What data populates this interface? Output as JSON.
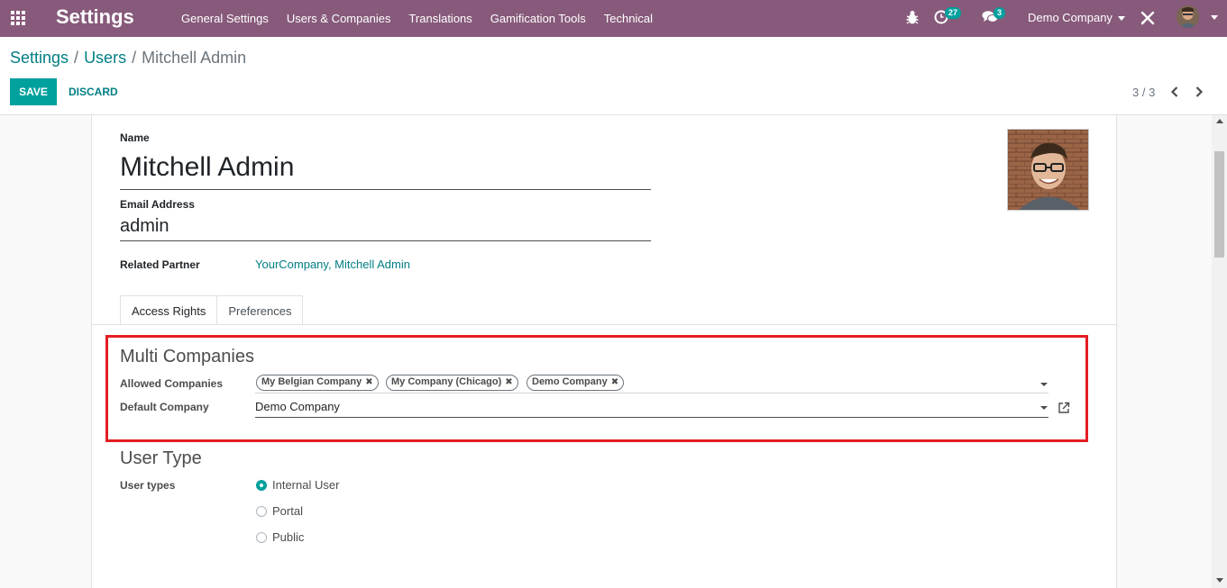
{
  "navbar": {
    "app_title": "Settings",
    "menu": [
      "General Settings",
      "Users & Companies",
      "Translations",
      "Gamification Tools",
      "Technical"
    ],
    "activity_count": "27",
    "message_count": "3",
    "company": "Demo Company",
    "icons": [
      "apps-icon",
      "bug-icon",
      "clock-icon",
      "chat-icon",
      "tools-icon",
      "avatar"
    ]
  },
  "breadcrumb": {
    "root": "Settings",
    "parent": "Users",
    "current": "Mitchell Admin",
    "separator": "/"
  },
  "actions": {
    "save": "SAVE",
    "discard": "DISCARD"
  },
  "pager": {
    "value": "3 / 3"
  },
  "form": {
    "name_label": "Name",
    "name": "Mitchell Admin",
    "email_label": "Email Address",
    "email": "admin",
    "partner_label": "Related Partner",
    "partner": "YourCompany, Mitchell Admin",
    "tabs": [
      "Access Rights",
      "Preferences"
    ],
    "multi_companies": {
      "title": "Multi Companies",
      "allowed_label": "Allowed Companies",
      "allowed": [
        "My Belgian Company",
        "My Company (Chicago)",
        "Demo Company"
      ],
      "default_label": "Default Company",
      "default": "Demo Company"
    },
    "user_type": {
      "title": "User Type",
      "label": "User types",
      "options": [
        "Internal User",
        "Portal",
        "Public"
      ],
      "selected": "Internal User"
    }
  },
  "colors": {
    "navbar": "#875a7b",
    "primary": "#00a09d",
    "link": "#017e84",
    "highlight": "#e31e24"
  }
}
